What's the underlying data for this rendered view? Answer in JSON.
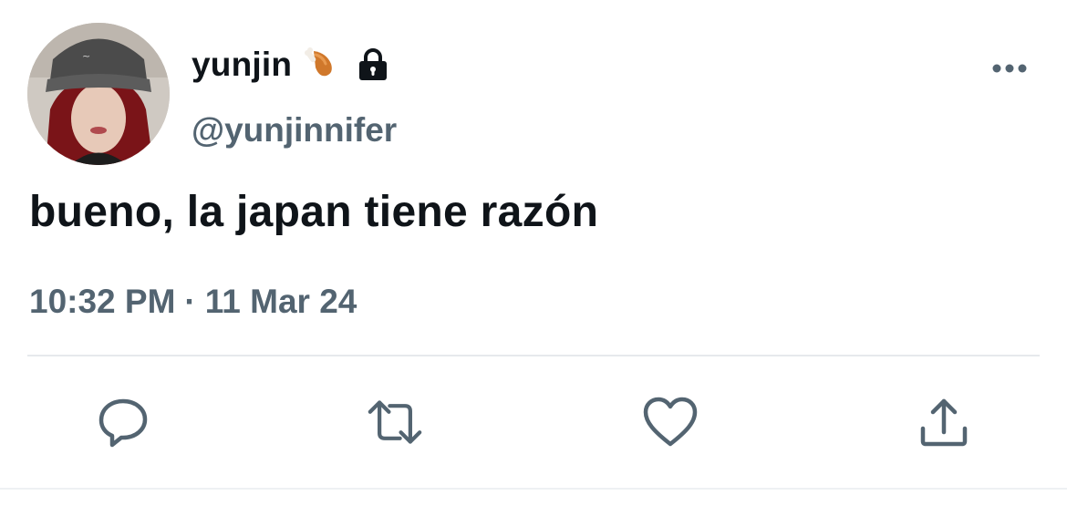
{
  "tweet": {
    "display_name": "yunjin",
    "name_emoji": "poultry-leg-emoji",
    "name_badge": "lock-icon",
    "handle": "@yunjinnifer",
    "text": "bueno, la japan tiene razón",
    "time": "10:32 PM",
    "separator": "·",
    "date": "11 Mar 24"
  },
  "actions": [
    {
      "name": "reply",
      "icon": "comment-icon"
    },
    {
      "name": "retweet",
      "icon": "retweet-icon"
    },
    {
      "name": "like",
      "icon": "heart-icon"
    },
    {
      "name": "share",
      "icon": "share-icon"
    }
  ],
  "colors": {
    "text_primary": "#0f1419",
    "text_secondary": "#536471",
    "icon_gray": "#536471",
    "divider": "#e6e9ec"
  }
}
